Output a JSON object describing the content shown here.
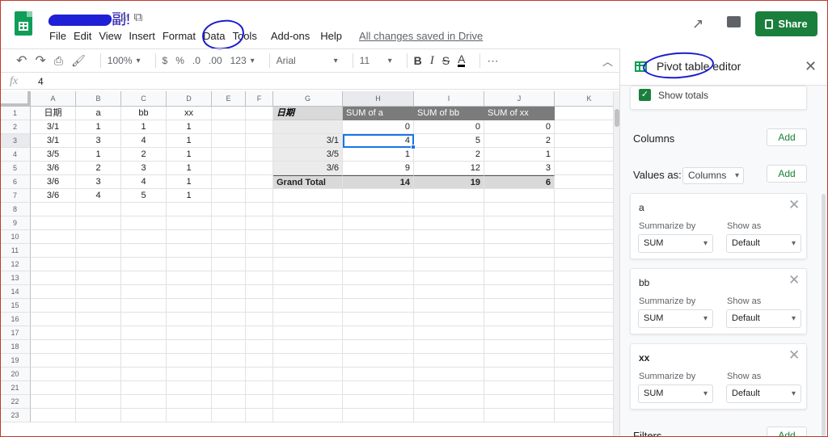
{
  "header": {
    "doc_title_visible": "副!",
    "menu": [
      "File",
      "Edit",
      "View",
      "Insert",
      "Format",
      "Data",
      "Tools",
      "Add-ons",
      "Help"
    ],
    "saved_status": "All changes saved in Drive",
    "share_label": "Share",
    "icons": [
      "star-icon",
      "move-to-folder-icon",
      "trending-up-icon",
      "comment-icon",
      "lock-icon"
    ]
  },
  "toolbar": {
    "zoom": "100%",
    "currency": "$",
    "percent": "%",
    "decrease_decimals": ".0",
    "increase_decimals": ".00",
    "more_formats": "123",
    "font": "Arial",
    "font_size": "11",
    "bold": "B",
    "italic": "I",
    "strike": "S",
    "text_color": "A",
    "more": "⋯"
  },
  "formula_bar": {
    "fx": "fx",
    "value": "4"
  },
  "grid": {
    "columns": [
      "A",
      "B",
      "C",
      "D",
      "E",
      "F",
      "G",
      "H",
      "I",
      "J",
      "K"
    ],
    "rows": [
      "1",
      "2",
      "3",
      "4",
      "5",
      "6",
      "7",
      "8",
      "9",
      "10",
      "11",
      "12",
      "13",
      "14",
      "15",
      "16",
      "17",
      "18",
      "19",
      "20",
      "21",
      "22",
      "23"
    ],
    "source": {
      "headers": [
        "日期",
        "a",
        "bb",
        "xx"
      ],
      "rows": [
        [
          "3/1",
          "1",
          "1",
          "1"
        ],
        [
          "3/1",
          "3",
          "4",
          "1"
        ],
        [
          "3/5",
          "1",
          "2",
          "1"
        ],
        [
          "3/6",
          "2",
          "3",
          "1"
        ],
        [
          "3/6",
          "3",
          "4",
          "1"
        ],
        [
          "3/6",
          "4",
          "5",
          "1"
        ]
      ]
    },
    "pivot": {
      "headers": [
        "日期",
        "SUM of a",
        "SUM of bb",
        "SUM of xx"
      ],
      "rows": [
        [
          "",
          "0",
          "0",
          "0"
        ],
        [
          "3/1",
          "4",
          "5",
          "2"
        ],
        [
          "3/5",
          "1",
          "2",
          "1"
        ],
        [
          "3/6",
          "9",
          "12",
          "3"
        ]
      ],
      "total": [
        "Grand Total",
        "14",
        "19",
        "6"
      ]
    }
  },
  "panel": {
    "title": "Pivot table editor",
    "show_totals": "Show totals",
    "columns_label": "Columns",
    "add_label": "Add",
    "values_as_label": "Values as:",
    "values_as_value": "Columns",
    "summarize_by_label": "Summarize by",
    "show_as_label": "Show as",
    "fields": [
      {
        "name": "a",
        "summarize": "SUM",
        "show_as": "Default"
      },
      {
        "name": "bb",
        "summarize": "SUM",
        "show_as": "Default"
      },
      {
        "name": "xx",
        "summarize": "SUM",
        "show_as": "Default"
      }
    ],
    "filters_label": "Filters"
  },
  "colors": {
    "brand_green": "#0f9d58",
    "share_green": "#1a7f3c",
    "selection_blue": "#1a73e8",
    "annotation_blue": "#1c1cd0"
  }
}
